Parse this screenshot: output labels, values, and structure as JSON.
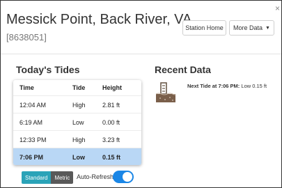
{
  "header": {
    "title": "Messick Point, Back River, VA",
    "station_id": "[8638051]",
    "station_home_label": "Station Home",
    "more_data_label": "More Data",
    "close_symbol": "×"
  },
  "todays_tides": {
    "title": "Today's Tides",
    "columns": [
      "Time",
      "Tide",
      "Height"
    ],
    "rows": [
      {
        "time": "12:04 AM",
        "tide": "High",
        "height": "2.81 ft"
      },
      {
        "time": "6:19 AM",
        "tide": "Low",
        "height": "0.00 ft"
      },
      {
        "time": "12:33 PM",
        "tide": "High",
        "height": "3.23 ft"
      },
      {
        "time": "7:06 PM",
        "tide": "Low",
        "height": "0.15 ft"
      }
    ]
  },
  "units": {
    "standard_label": "Standard",
    "metric_label": "Metric",
    "selected": "Standard"
  },
  "auto_refresh": {
    "label": "Auto-Refresh:",
    "enabled": true
  },
  "recent_data": {
    "title": "Recent Data",
    "icon": "tide-gauge-icon",
    "next_tide_prefix": "Next Tide at 7:06 PM:",
    "next_tide_value": "Low 0.15 ft"
  },
  "colors": {
    "accent": "#2aa3b8",
    "toggle_on": "#1a86e6",
    "highlight_row": "#b9d7f5"
  }
}
